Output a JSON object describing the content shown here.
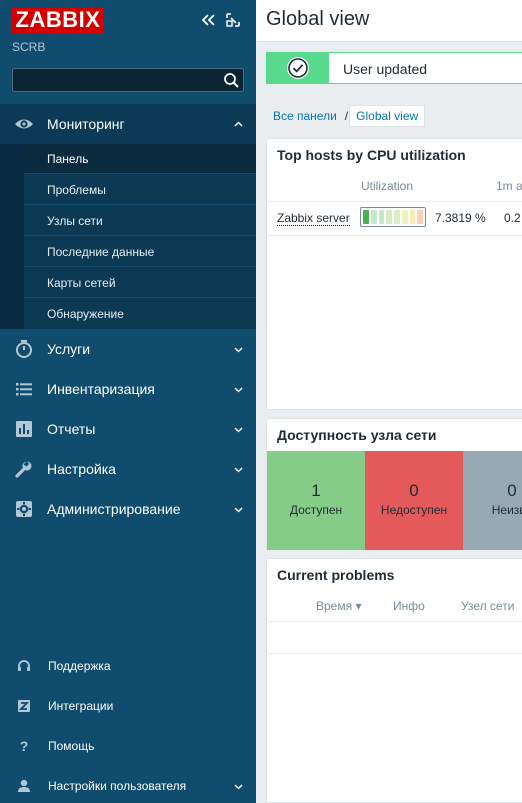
{
  "sidebar": {
    "logo": "ZABBIX",
    "server_name": "SCRB",
    "search_value": "",
    "sections": [
      {
        "label": "Мониторинг",
        "icon": "eye-icon",
        "expanded": true
      },
      {
        "label": "Услуги",
        "icon": "stopwatch-icon",
        "expanded": false
      },
      {
        "label": "Инвентаризация",
        "icon": "list-icon",
        "expanded": false
      },
      {
        "label": "Отчеты",
        "icon": "bar-chart-icon",
        "expanded": false
      },
      {
        "label": "Настройка",
        "icon": "wrench-icon",
        "expanded": false
      },
      {
        "label": "Администрирование",
        "icon": "gear-icon",
        "expanded": false
      }
    ],
    "monitoring_items": [
      {
        "label": "Панель",
        "selected": true
      },
      {
        "label": "Проблемы",
        "selected": false
      },
      {
        "label": "Узлы сети",
        "selected": false
      },
      {
        "label": "Последние данные",
        "selected": false
      },
      {
        "label": "Карты сетей",
        "selected": false
      },
      {
        "label": "Обнаружение",
        "selected": false
      }
    ],
    "footer": [
      {
        "label": "Поддержка",
        "icon": "headset-icon"
      },
      {
        "label": "Интеграции",
        "icon": "integrations-icon"
      },
      {
        "label": "Помощь",
        "icon": "help-icon"
      },
      {
        "label": "Настройки пользователя",
        "icon": "user-icon"
      }
    ]
  },
  "header": {
    "title": "Global view"
  },
  "message": {
    "text": "User updated",
    "type": "success"
  },
  "breadcrumb": {
    "root": "Все панели",
    "separator": "/",
    "current": "Global view"
  },
  "widgets": {
    "top_hosts": {
      "title": "Top hosts by CPU utilization",
      "columns": [
        "Utilization",
        "1m a"
      ],
      "rows": [
        {
          "host": "Zabbix server",
          "utilization": "7.3819 %",
          "load": "0.2",
          "gauge_fraction": 0.073
        }
      ]
    },
    "availability": {
      "title": "Доступность узла сети",
      "tiles": [
        {
          "count": "1",
          "label": "Доступен",
          "color": "#86cc89"
        },
        {
          "count": "0",
          "label": "Недоступен",
          "color": "#e45959"
        },
        {
          "count": "0",
          "label": "Неизве",
          "color": "#97aab3"
        }
      ]
    },
    "problems": {
      "title": "Current problems",
      "columns": [
        "Время",
        "Инфо",
        "Узел сети"
      ],
      "sort_indicator": "▾"
    }
  },
  "colors": {
    "sidebar_bg": "#0f4c6e",
    "logo_red": "#d40000",
    "success_green": "#59db8f",
    "link_blue": "#0275b8"
  }
}
